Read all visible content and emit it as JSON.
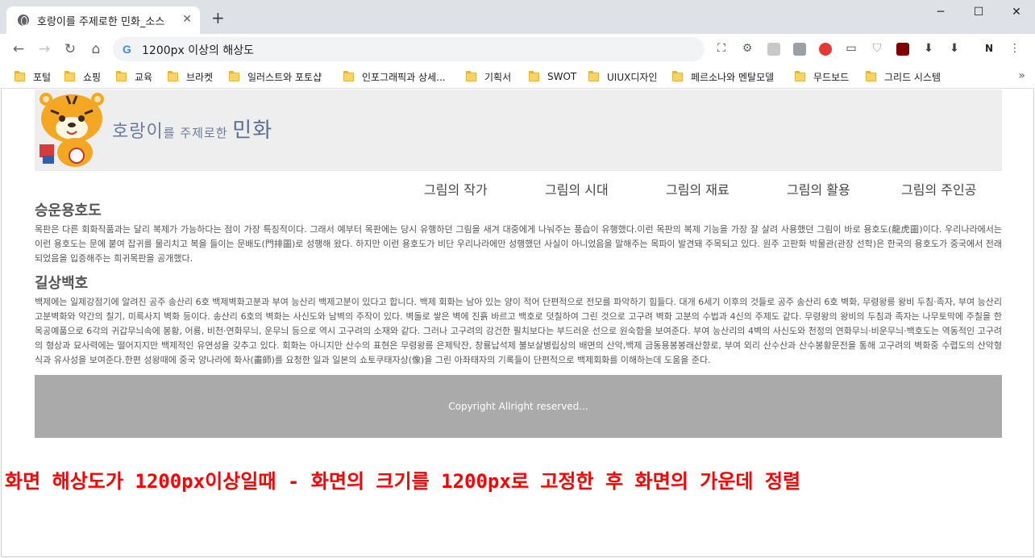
{
  "browser": {
    "tab_title": "호랑이를 주제로한 민화_소스",
    "tab_close": "✕",
    "new_tab": "+",
    "url": "1200px 이상의 해상도",
    "bookmarks": [
      "포털",
      "쇼핑",
      "교육",
      "브라켓",
      "일러스트와 포토샵",
      "인포그래픽과 상세...",
      "기획서",
      "SWOT",
      "UIUX디자인",
      "페르소나와 멘탈모델",
      "무드보드",
      "그리드 시스템"
    ],
    "more": "»"
  },
  "site": {
    "logo": {
      "part1": "호랑이",
      "part2": "를 주제로한 ",
      "part3": "민화"
    },
    "nav": [
      "그림의 작가",
      "그림의 시대",
      "그림의 재료",
      "그림의 활용",
      "그림의 주인공"
    ],
    "sections": [
      {
        "title": "승운용호도",
        "body": "목판은 다른 회화작품과는 달리 복제가 가능하다는 점이 가장 특징적이다. 그래서 예부터 목판에는 당시 유행하던 그림을 새겨 대중에게 나눠주는 풍습이 유행했다.이런 목판의 복제 기능을 가장 잘 살려 사용했던 그림이 바로 용호도(龍虎圖)이다. 우리나라에서는 이런 용호도는 문에 붙여 잡귀를 물리치고 복을 들이는 문배도(門排圖)로 성행해 왔다. 하지만 이런 용호도가 비단 우리나라에만 성행했던 사실이 아니었음을 말해주는 목파이 발견돼 주목되고 있다. 원주 고판화 박물관(관장 선학)은 한국의 용호도가 중국에서 전래되었음을 입증해주는 희귀목판을 공개했다."
      },
      {
        "title": "길상백호",
        "body": "백제에는 일제강점기에 알려진 공주 송산리 6호 백제벽화고분과 부여 능산리 백제고분이 있다고 합니다. 백제 회화는 남아 있는 양이 적어 단편적으로 전모를 파악하기 힘들다. 대개 6세기 이후의 것들로 공주 송산리 6호 벽화, 무령왕릉 왕비 두침·족자, 부여 능산리 고분벽화와 약간의 칠기, 미륵사지 벽화 등이다. 송산리 6호의 벽화는 사신도와 남벽의 주작이 있다. 벽돌로 쌓은 벽에 진흙 바르고 백호로 덧칠하여 그린 것으로 고구려 벽화 고분의 수법과 4신의 주제도 같다. 무령왕의 왕비의 두침과 족자는 나무토막에 주칠을 한 목공예품으로 6각의 귀갑무늬속에 봉황, 어룡, 비천·연화무늬, 운무늬 등으로 역시 고구려의 소재와 같다. 그러나 고구려의 강건한 필치보다는 부드러운 선으로 원숙함을 보여준다. 부여 능산리의 4벽의 사신도와 천정의 연화무늬·비운무늬·백호도는 역동적인 고구려의 형상과 묘사력에는 떨어지지만 백제적인 유연성을 갖추고 있다. 회화는 아니지만 산수의 표현은 무령왕릉 은제탁잔, 창룡납석제 불보살병립상의 배면의 산악,백제 금동용봉봉래산향로, 부여 외리 산수산과 산수봉황문전을 통해 고구려의 벽화중 수렵도의 산악형식과 유사성을 보여준다.한편 성왕때에 중국 양나라에 화사(畵師)를 요청한 일과 일본의 쇼토쿠태자상(像)을 그린 아좌태자의 기록들이 단편적으로 백제회화를 이해하는데 도움을 준다."
      }
    ],
    "footer": "Copyright Allright reserved..."
  },
  "caption": "화면 해상도가 1200px이상일때 -  화면의 크기를 1200px로 고정한 후 화면의 가운데 정렬",
  "colors": {
    "header_bg": "#eeeeee",
    "footer_bg": "#aaaaaa",
    "caption": "#ff0000",
    "logo_text": "#6b7b9b"
  }
}
